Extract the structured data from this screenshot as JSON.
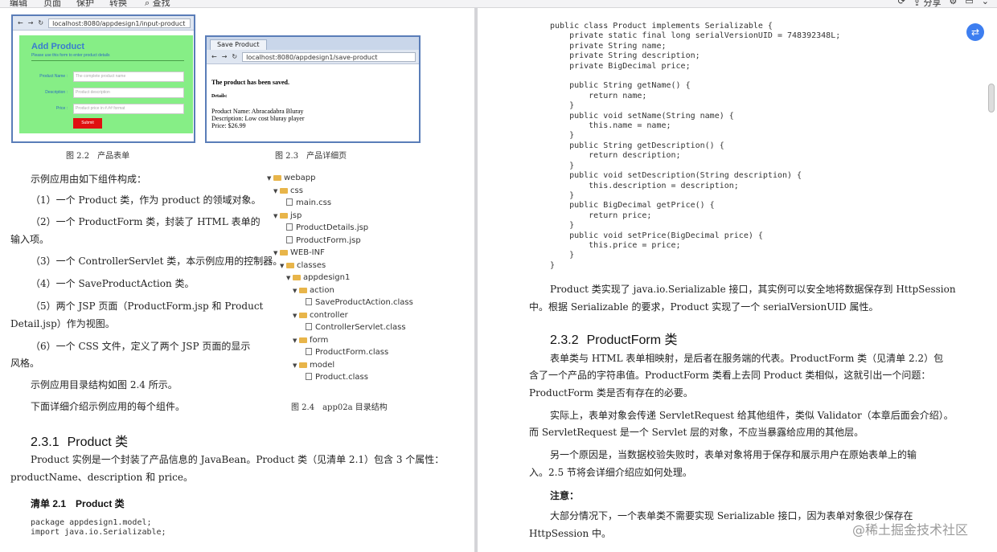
{
  "toolbar": {
    "menu": [
      "编辑",
      "页面",
      "保护",
      "转换",
      "查找"
    ],
    "share": "分享"
  },
  "fig22": {
    "url": "localhost:8080/appdesign1/input-product",
    "title": "Add Product",
    "subtitle": "Please use this form to enter product details",
    "fields": [
      {
        "label": "Product Name :",
        "placeholder": "The complete product name"
      },
      {
        "label": "Description :",
        "placeholder": "Product description"
      },
      {
        "label": "Price :",
        "placeholder": "Product price in #.## format"
      }
    ],
    "submit": "Submit",
    "caption": "图 2.2　产品表单"
  },
  "fig23": {
    "tab": "Save Product",
    "url": "localhost:8080/appdesign1/save-product",
    "saved": "The product has been saved.",
    "details": "Details:",
    "line1": "Product Name: Abracadabra Bluray",
    "line2": "Description: Low cost bluray player",
    "line3": "Price: $26.99",
    "caption": "图 2.3　产品详细页"
  },
  "left": {
    "intro": "示例应用由如下组件构成：",
    "items": [
      "（1）一个 Product 类，作为 product 的领域对象。",
      "（2）一个 ProductForm 类，封装了 HTML 表单的",
      "输入项。",
      "（3）一个 ControllerServlet 类，本示例应用的控制器。",
      "（4）一个 SaveProductAction 类。",
      "（5）两个 JSP 页面（ProductForm.jsp 和 Product",
      "Detail.jsp）作为视图。",
      "（6）一个 CSS 文件，定义了两个 JSP 页面的显示",
      "风格。",
      "示例应用目录结构如图 2.4 所示。",
      "下面详细介绍示例应用的每个组件。"
    ],
    "section_num": "2.3.1",
    "section_title": "Product 类",
    "section_para1": "Product 实例是一个封装了产品信息的 JavaBean。Product 类（见清单 2.1）包含 3 个属性：",
    "section_para2": "productName、description 和 price。",
    "listing": "清单 2.1　Product 类",
    "code": "package appdesign1.model;\nimport java.io.Serializable;"
  },
  "tree": {
    "nodes": [
      {
        "label": "webapp",
        "type": "folder",
        "indent": 0
      },
      {
        "label": "css",
        "type": "folder",
        "indent": 1
      },
      {
        "label": "main.css",
        "type": "file",
        "indent": 2
      },
      {
        "label": "jsp",
        "type": "folder",
        "indent": 1
      },
      {
        "label": "ProductDetails.jsp",
        "type": "file",
        "indent": 2
      },
      {
        "label": "ProductForm.jsp",
        "type": "file",
        "indent": 2
      },
      {
        "label": "WEB-INF",
        "type": "folder",
        "indent": 1
      },
      {
        "label": "classes",
        "type": "folder",
        "indent": 2
      },
      {
        "label": "appdesign1",
        "type": "folder",
        "indent": 3
      },
      {
        "label": "action",
        "type": "folder",
        "indent": 4
      },
      {
        "label": "SaveProductAction.class",
        "type": "file",
        "indent": 5
      },
      {
        "label": "controller",
        "type": "folder",
        "indent": 4
      },
      {
        "label": "ControllerServlet.class",
        "type": "file",
        "indent": 5
      },
      {
        "label": "form",
        "type": "folder",
        "indent": 4
      },
      {
        "label": "ProductForm.class",
        "type": "file",
        "indent": 5
      },
      {
        "label": "model",
        "type": "folder",
        "indent": 4
      },
      {
        "label": "Product.class",
        "type": "file",
        "indent": 5
      }
    ],
    "caption": "图 2.4　app02a 目录结构"
  },
  "right": {
    "code": "public class Product implements Serializable {\n    private static final long serialVersionUID = 748392348L;\n    private String name;\n    private String description;\n    private BigDecimal price;\n\n    public String getName() {\n        return name;\n    }\n    public void setName(String name) {\n        this.name = name;\n    }\n    public String getDescription() {\n        return description;\n    }\n    public void setDescription(String description) {\n        this.description = description;\n    }\n    public BigDecimal getPrice() {\n        return price;\n    }\n    public void setPrice(BigDecimal price) {\n        this.price = price;\n    }\n}",
    "para1a": "Product 类实现了 java.io.Serializable 接口，其实例可以安全地将数据保存到 HttpSession",
    "para1b": "中。根据 Serializable 的要求，Product 实现了一个 serialVersionUID 属性。",
    "section_num": "2.3.2",
    "section_title": "ProductForm 类",
    "para2a": "表单类与 HTML 表单相映射，是后者在服务端的代表。ProductForm 类（见清单 2.2）包",
    "para2b": "含了一个产品的字符串值。ProductForm 类看上去同 Product 类相似，这就引出一个问题：",
    "para2c": "ProductForm 类是否有存在的必要。",
    "para3a": "实际上，表单对象会传递 ServletRequest 给其他组件，类似 Validator（本章后面会介绍）。",
    "para3b": "而 ServletRequest 是一个 Servlet 层的对象，不应当暴露给应用的其他层。",
    "para4a": "另一个原因是，当数据校验失败时，表单对象将用于保存和展示用户在原始表单上的输",
    "para4b": "入。2.5 节将会详细介绍应如何处理。",
    "note_title": "注意：",
    "note_a": "大部分情况下，一个表单类不需要实现 Serializable 接口，因为表单对象很少保存在",
    "note_b": "HttpSession 中。"
  },
  "watermark": "@稀土掘金技术社区"
}
